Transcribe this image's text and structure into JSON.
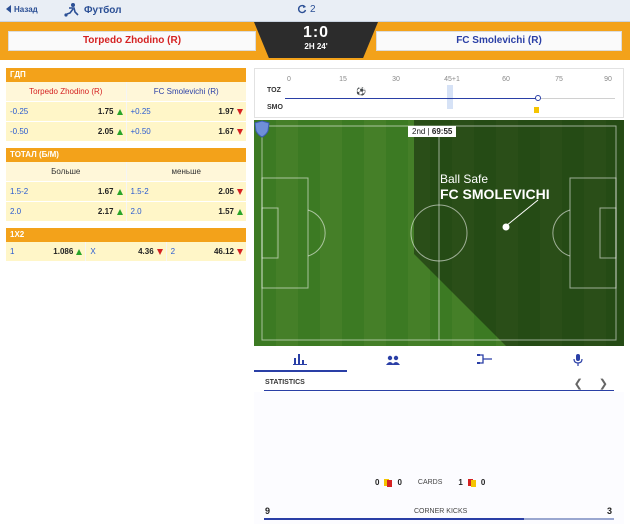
{
  "nav": {
    "back_label": "Назад",
    "sport_label": "Футбол",
    "refresh_count": "2"
  },
  "match": {
    "home_team": "Torpedo Zhodino (R)",
    "away_team": "FC Smolevichi (R)",
    "score": "1:0",
    "clock": "2H 24'"
  },
  "markets": {
    "handicap": {
      "title": "ГДП",
      "columns": [
        "Torpedo Zhodino (R)",
        "FC Smolevichi (R)"
      ],
      "rows": [
        {
          "home_line": "-0.25",
          "home_odds": "1.75",
          "away_line": "+0.25",
          "away_odds": "1.97"
        },
        {
          "home_line": "-0.50",
          "home_odds": "2.05",
          "away_line": "+0.50",
          "away_odds": "1.67"
        }
      ]
    },
    "total": {
      "title": "ТОТАЛ (Б/М)",
      "columns": [
        "Больше",
        "меньше"
      ],
      "rows": [
        {
          "over_line": "1.5-2",
          "over_odds": "1.67",
          "under_line": "1.5-2",
          "under_odds": "2.05"
        },
        {
          "over_line": "2.0",
          "over_odds": "2.17",
          "under_line": "2.0",
          "under_odds": "1.57"
        }
      ]
    },
    "one_x_two": {
      "title": "1X2",
      "labels": [
        "1",
        "X",
        "2"
      ],
      "odds": [
        "1.086",
        "4.36",
        "46.12"
      ]
    }
  },
  "timeline": {
    "ticks": [
      "0",
      "15",
      "30",
      "45+1",
      "60",
      "75",
      "90"
    ],
    "home_code": "TOZ",
    "away_code": "SMO"
  },
  "pitch": {
    "period": "2nd",
    "time": "69:55",
    "event": "Ball Safe",
    "team": "FC SMOLEVICHI"
  },
  "stats": {
    "title": "STATISTICS",
    "cards_label": "CARDS",
    "home_yellow": "0",
    "home_red": "0",
    "away_yellow": "1",
    "away_red": "0",
    "corner_label": "CORNER KICKS",
    "home_corners": "9",
    "away_corners": "3"
  },
  "colors": {
    "accent": "#f3a21a",
    "home": "#d52222",
    "away": "#2a3fa6",
    "up": "#2aa52a",
    "down": "#d52222"
  }
}
